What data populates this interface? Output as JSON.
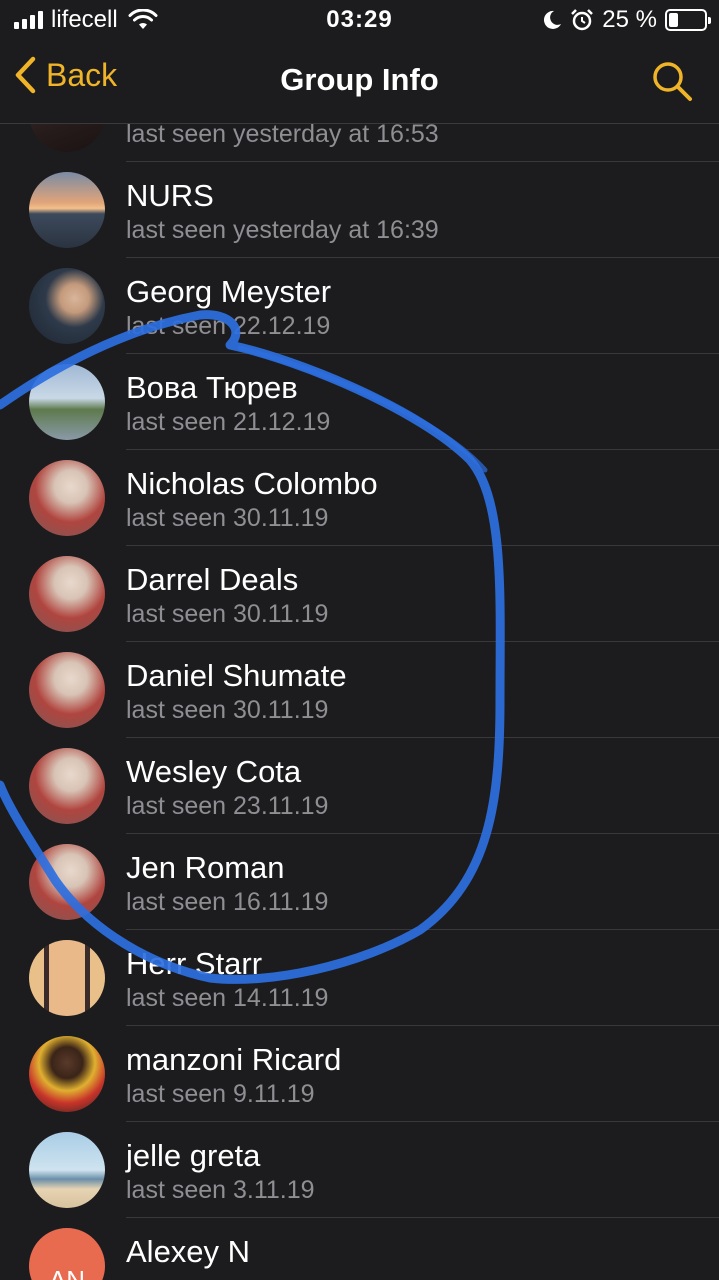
{
  "status_bar": {
    "carrier": "lifecell",
    "time": "03:29",
    "battery_percent": "25 %",
    "battery_level": 0.25
  },
  "nav": {
    "back_label": "Back",
    "title": "Group Info"
  },
  "members": [
    {
      "name": "",
      "status": "last seen yesterday at 16:53"
    },
    {
      "name": "NURS",
      "status": "last seen yesterday at 16:39"
    },
    {
      "name": "Georg Meyster",
      "status": "last seen 22.12.19"
    },
    {
      "name": "Вова Тюрев",
      "status": "last seen 21.12.19"
    },
    {
      "name": "Nicholas Colombo",
      "status": "last seen 30.11.19"
    },
    {
      "name": "Darrel Deals",
      "status": "last seen 30.11.19"
    },
    {
      "name": "Daniel Shumate",
      "status": "last seen 30.11.19"
    },
    {
      "name": "Wesley Cota",
      "status": "last seen 23.11.19"
    },
    {
      "name": "Jen Roman",
      "status": "last seen 16.11.19"
    },
    {
      "name": "Herr Starr",
      "status": "last seen 14.11.19"
    },
    {
      "name": "manzoni Ricard",
      "status": "last seen 9.11.19"
    },
    {
      "name": "jelle greta",
      "status": "last seen 3.11.19"
    },
    {
      "name": "Alexey N",
      "status": "",
      "initials": "AN"
    }
  ],
  "colors": {
    "accent": "#f0b429",
    "background": "#1c1c1e",
    "secondary_text": "#8e8e93",
    "scribble": "#2d6fe0",
    "initials_avatar": "#e86a4f"
  }
}
